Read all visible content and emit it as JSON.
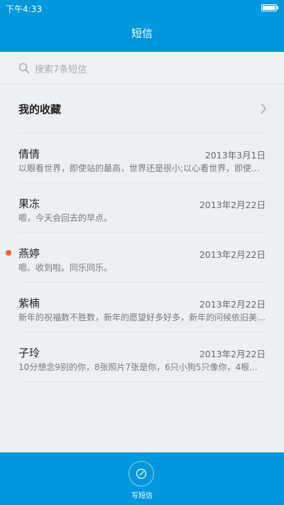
{
  "status_bar": {
    "time": "下午4:33"
  },
  "header": {
    "title": "短信"
  },
  "search": {
    "placeholder": "搜索7条短信"
  },
  "favorites": {
    "label": "我的收藏"
  },
  "conversations": [
    {
      "name": "倩倩",
      "date": "2013年3月1日",
      "preview": "以眼看世界，即使站的最高，世界还是很小;以心看世界，即使身…",
      "unread": false
    },
    {
      "name": "果冻",
      "date": "2013年2月22日",
      "preview": "嗯，今天会回去的早点。",
      "unread": false
    },
    {
      "name": "燕婷",
      "date": "2013年2月22日",
      "preview": "嗯。收到啦。同乐同乐。",
      "unread": true
    },
    {
      "name": "紫楠",
      "date": "2013年2月22日",
      "preview": "新年的祝福数不胜数，新年的愿望好多好多，新年的问候依旧美…",
      "unread": false
    },
    {
      "name": "子玲",
      "date": "2013年2月22日",
      "preview": "10分想念9别的你，8张照片7张是你，6只小狗5只像你，4根骨…",
      "unread": false
    }
  ],
  "bottom_bar": {
    "compose_label": "写短信"
  },
  "colors": {
    "primary": "#0098dc",
    "unread": "#f2622e",
    "background": "#edf0f3"
  }
}
